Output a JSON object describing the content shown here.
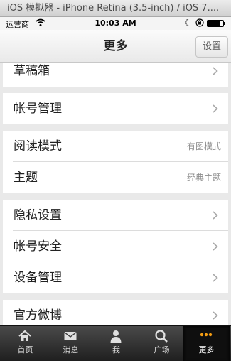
{
  "window": {
    "title": "iOS 模拟器 - iPhone Retina (3.5-inch) / iOS 7...."
  },
  "status_bar": {
    "carrier": "运营商",
    "time": "10:03 AM",
    "battery_level": 0.85
  },
  "nav": {
    "title": "更多",
    "settings_label": "设置"
  },
  "menu": {
    "drafts": "草稿箱",
    "account_manage": "帐号管理",
    "reading_mode": "阅读模式",
    "reading_mode_value": "有图模式",
    "theme": "主题",
    "theme_value": "经典主题",
    "privacy": "隐私设置",
    "account_security": "帐号安全",
    "device_manage": "设备管理",
    "official_weibo": "官方微博"
  },
  "tabs": [
    {
      "label": "首页",
      "icon": "home-icon"
    },
    {
      "label": "消息",
      "icon": "envelope-icon"
    },
    {
      "label": "我",
      "icon": "person-icon"
    },
    {
      "label": "广场",
      "icon": "search-icon"
    },
    {
      "label": "更多",
      "icon": "more-dots-icon"
    }
  ],
  "colors": {
    "accent_more": "#f39c12",
    "tab_bar": "#2b2b2b",
    "group_bg": "#e9e9e9"
  }
}
